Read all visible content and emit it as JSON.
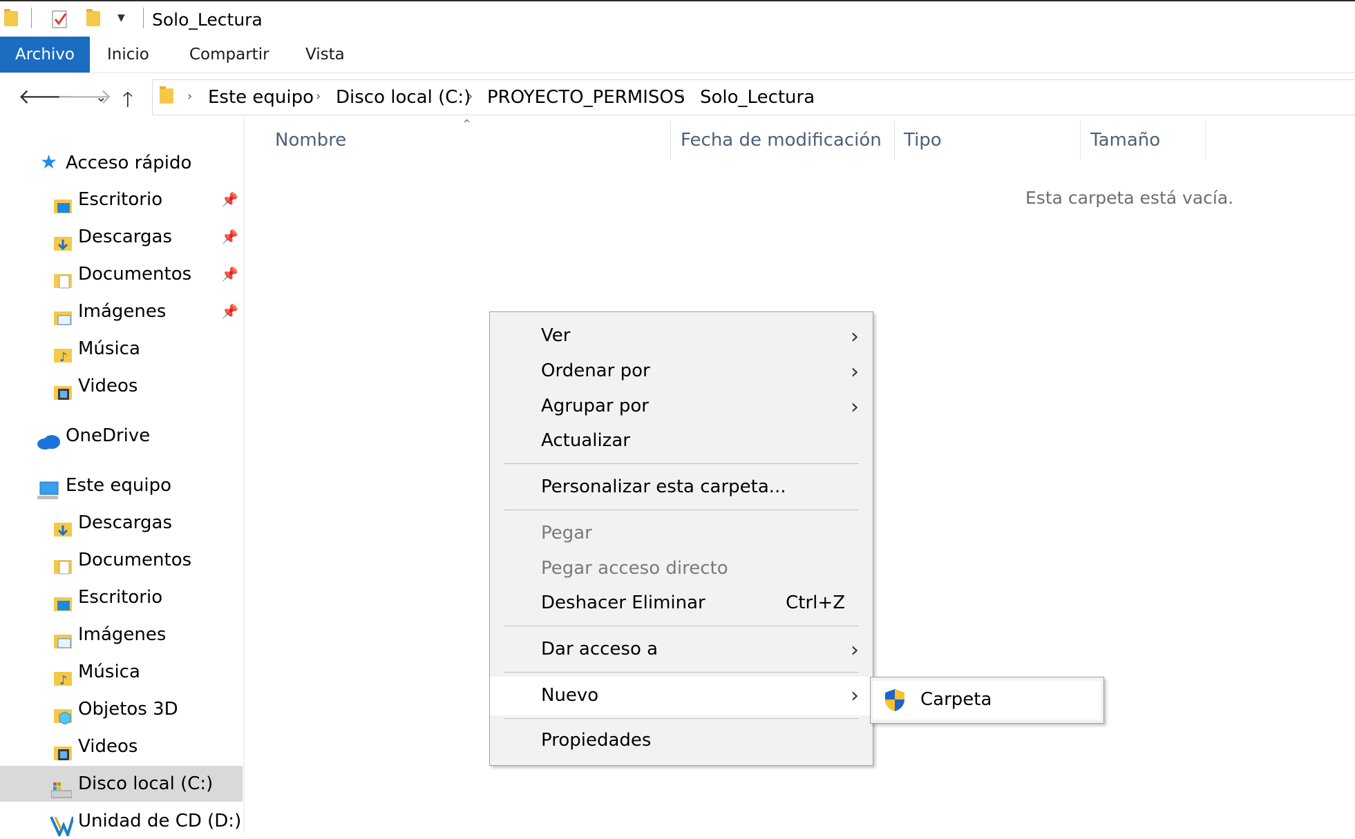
{
  "window": {
    "title": "Solo_Lectura"
  },
  "ribbon": {
    "tabs": [
      "Archivo",
      "Inicio",
      "Compartir",
      "Vista"
    ]
  },
  "address": {
    "crumbs": [
      "Este equipo",
      "Disco local (C:)",
      "PROYECTO_PERMISOS",
      "Solo_Lectura"
    ]
  },
  "sidebar": {
    "quick_access": "Acceso rápido",
    "quick_items": [
      "Escritorio",
      "Descargas",
      "Documentos",
      "Imágenes",
      "Música",
      "Videos"
    ],
    "onedrive": "OneDrive",
    "this_pc": "Este equipo",
    "pc_items": [
      "Descargas",
      "Documentos",
      "Escritorio",
      "Imágenes",
      "Música",
      "Objetos 3D",
      "Videos",
      "Disco local (C:)",
      "Unidad de CD (D:) V"
    ]
  },
  "columns": {
    "name": "Nombre",
    "date": "Fecha de modificación",
    "type": "Tipo",
    "size": "Tamaño"
  },
  "content": {
    "empty_message": "Esta carpeta está vacía."
  },
  "context_menu": {
    "view": "Ver",
    "sort_by": "Ordenar por",
    "group_by": "Agrupar por",
    "refresh": "Actualizar",
    "customize": "Personalizar esta carpeta...",
    "paste": "Pegar",
    "paste_shortcut": "Pegar acceso directo",
    "undo_delete": "Deshacer Eliminar",
    "undo_shortcut": "Ctrl+Z",
    "give_access": "Dar acceso a",
    "new": "Nuevo",
    "properties": "Propiedades"
  },
  "submenu": {
    "folder": "Carpeta"
  },
  "colors": {
    "accent": "#1a6dc0",
    "folder": "#f5c84a",
    "selected_bg": "#d9d9d9"
  }
}
